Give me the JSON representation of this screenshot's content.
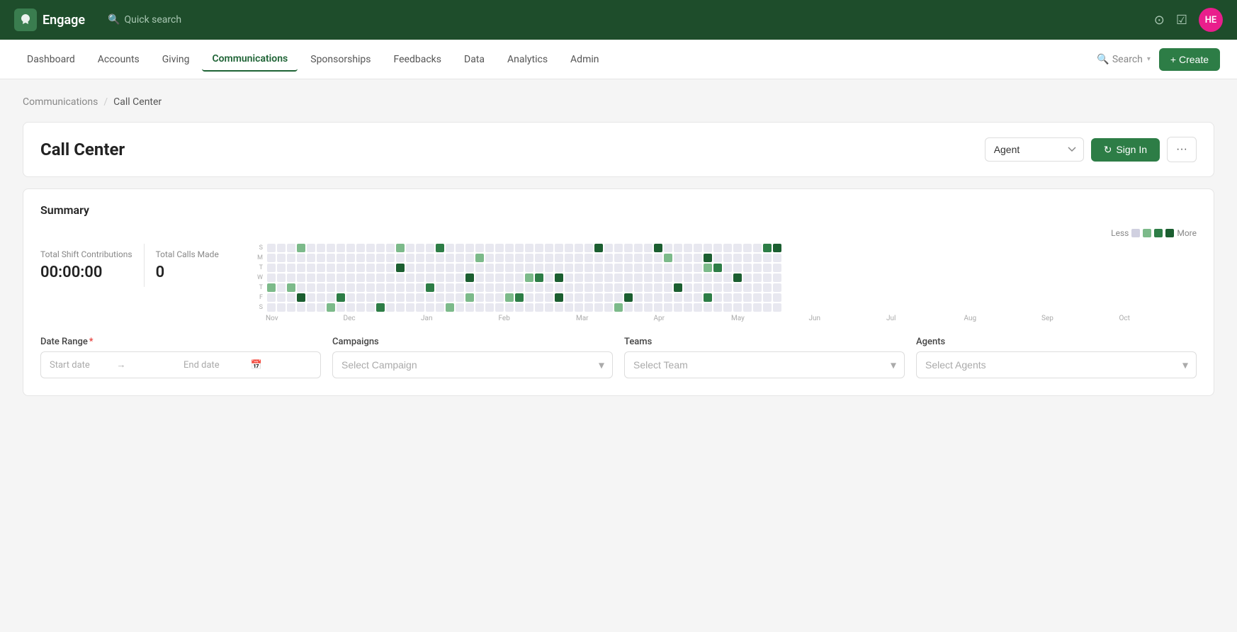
{
  "topbar": {
    "app_name": "Engage",
    "quick_search_placeholder": "Quick search",
    "avatar_initials": "HE"
  },
  "nav": {
    "items": [
      {
        "label": "Dashboard",
        "active": false
      },
      {
        "label": "Accounts",
        "active": false
      },
      {
        "label": "Giving",
        "active": false
      },
      {
        "label": "Communications",
        "active": true
      },
      {
        "label": "Sponsorships",
        "active": false
      },
      {
        "label": "Feedbacks",
        "active": false
      },
      {
        "label": "Data",
        "active": false
      },
      {
        "label": "Analytics",
        "active": false
      },
      {
        "label": "Admin",
        "active": false
      }
    ],
    "search_label": "Search",
    "create_label": "+ Create"
  },
  "breadcrumb": {
    "parent": "Communications",
    "current": "Call Center"
  },
  "call_center": {
    "title": "Call Center",
    "agent_select_label": "Agent",
    "signin_label": "Sign In",
    "more_label": "···"
  },
  "summary": {
    "title": "Summary",
    "legend_less": "Less",
    "legend_more": "More",
    "total_shift_label": "Total Shift Contributions",
    "total_shift_value": "00:00:00",
    "total_calls_label": "Total Calls Made",
    "total_calls_value": "0",
    "heatmap": {
      "day_labels": [
        "S",
        "M",
        "T",
        "W",
        "T",
        "F",
        "S"
      ],
      "month_labels": [
        "Nov",
        "Dec",
        "Jan",
        "Feb",
        "Mar",
        "Apr",
        "May",
        "Jun",
        "Jul",
        "Aug",
        "Sep",
        "Oct"
      ]
    }
  },
  "filters": {
    "date_range_label": "Date Range",
    "date_required": true,
    "start_placeholder": "Start date",
    "end_placeholder": "End date",
    "campaigns_label": "Campaigns",
    "campaigns_placeholder": "Select Campaign",
    "teams_label": "Teams",
    "teams_placeholder": "Select Team",
    "agents_label": "Agents",
    "agents_placeholder": "Select Agents"
  }
}
